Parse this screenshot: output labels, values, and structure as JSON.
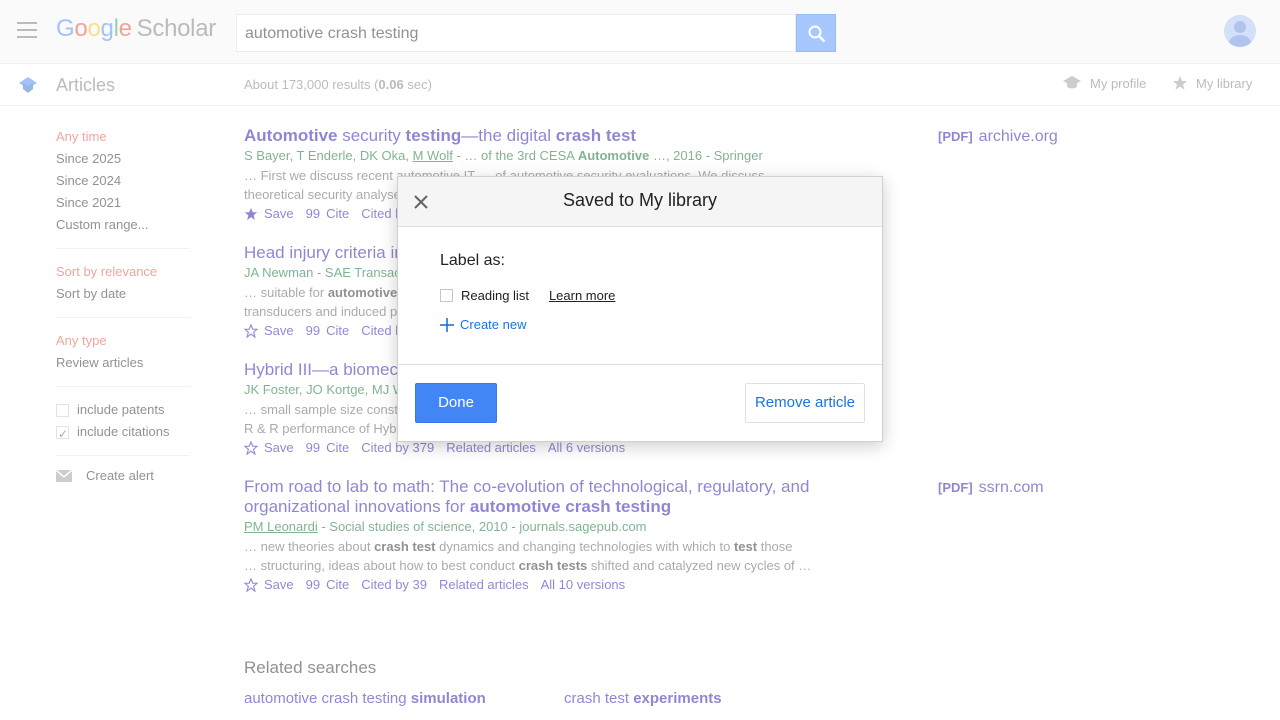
{
  "header": {
    "logo_parts": [
      "G",
      "o",
      "o",
      "g",
      "l",
      "e"
    ],
    "logo_suffix": "Scholar",
    "search_value": "automotive crash testing"
  },
  "subbar": {
    "section_title": "Articles",
    "results_prefix": "About 173,000 results (",
    "results_time": "0.06",
    "results_suffix": " sec)",
    "my_profile": "My profile",
    "my_library": "My library"
  },
  "sidebar": {
    "time": [
      "Any time",
      "Since 2025",
      "Since 2024",
      "Since 2021",
      "Custom range..."
    ],
    "sort": [
      "Sort by relevance",
      "Sort by date"
    ],
    "type": [
      "Any type",
      "Review articles"
    ],
    "include_patents": "include patents",
    "include_citations": "include citations",
    "create_alert": "Create alert"
  },
  "results": [
    {
      "title_parts": [
        "Automotive",
        " security ",
        "testing",
        "—the digital ",
        "crash test"
      ],
      "meta_author_link": "M Wolf",
      "meta_pre": "S Bayer, T Enderle, DK Oka, ",
      "meta_post": " - … of the 3rd CESA ",
      "meta_bold": "Automotive",
      "meta_tail": " …, 2016 - Springer",
      "snippet1": "… First we discuss recent automotive IT … of automotive security evaluations. We discuss",
      "snippet2": "theoretical security analyses",
      "save": "Save",
      "cite": "Cite",
      "cited_by": "Cited by",
      "pdf_tag": "[PDF]",
      "pdf_source": "archive.org"
    },
    {
      "title": "Head injury criteria in",
      "meta": "JA Newman - SAE Transac",
      "snippet1_pre": "… suitable for ",
      "snippet1_bold": "automotive",
      "snippet2": "transducers and induced p",
      "save": "Save",
      "cite": "Cite",
      "cited_by": "Cited b"
    },
    {
      "title": "Hybrid III—a biomec",
      "meta": "JK Foster, JO Kortge, MJ W",
      "snippet1": "… small sample size const",
      "snippet2": "R & R performance of Hybrid III and Hybrid II. Measurement of R & R requires repeated or …",
      "save": "Save",
      "cite": "Cite",
      "cited_by": "Cited by 379",
      "related": "Related articles",
      "versions": "All 6 versions"
    },
    {
      "title_line1": "From road to lab to math: The co-evolution of technological, regulatory, and",
      "title_line2_pre": "organizational innovations for ",
      "title_line2_bold": "automotive crash testing",
      "meta_author_link": "PM Leonardi",
      "meta_tail": " - Social studies of science, 2010 - journals.sagepub.com",
      "s1_a": "… new theories about ",
      "s1_b": "crash test",
      "s1_c": " dynamics and changing technologies with which to ",
      "s1_d": "test",
      "s1_e": " those",
      "s2_a": "… structuring, ideas about how to best conduct ",
      "s2_b": "crash tests",
      "s2_c": " shifted and catalyzed new cycles of …",
      "save": "Save",
      "cite": "Cite",
      "cited_by": "Cited by 39",
      "related": "Related articles",
      "versions": "All 10 versions",
      "pdf_tag": "[PDF]",
      "pdf_source": "ssrn.com"
    }
  ],
  "related_searches": {
    "title": "Related searches",
    "items": [
      {
        "plain": "automotive crash testing ",
        "bold": "simulation"
      },
      {
        "plain": "crash test ",
        "bold": "experiments"
      }
    ]
  },
  "dialog": {
    "title": "Saved to My library",
    "label_as": "Label as:",
    "reading_list": "Reading list",
    "learn_more": "Learn more",
    "create_new": "Create new",
    "done": "Done",
    "remove": "Remove article"
  },
  "colors": {
    "link": "#1a0dab",
    "accent_red": "#dd4b39",
    "primary_button": "#4285f4",
    "search_button": "#4d90fe"
  }
}
